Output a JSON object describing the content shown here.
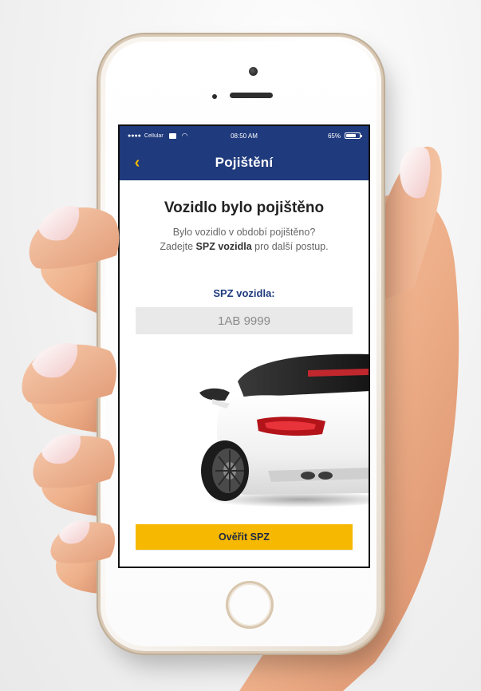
{
  "status_bar": {
    "carrier": "Cellular",
    "time": "08:50 AM",
    "battery": "65%",
    "icons": [
      "signal-dots-icon",
      "message-icon",
      "wifi-icon",
      "battery-icon"
    ]
  },
  "nav": {
    "back_icon": "chevron-left-icon",
    "title": "Pojištění"
  },
  "content": {
    "heading": "Vozidlo bylo pojištěno",
    "description_line1": "Bylo vozidlo v období pojištěno?",
    "description_line2_prefix": "Zadejte ",
    "description_line2_bold": "SPZ vozidla",
    "description_line2_suffix": " pro další postup.",
    "field_label": "SPZ vozidla:",
    "spz_placeholder": "1AB 9999",
    "verify_button": "Ověřit SPZ"
  },
  "colors": {
    "primary": "#1f3a7d",
    "accent": "#f6b800",
    "input_bg": "#e9e9e9",
    "heading": "#222222"
  }
}
